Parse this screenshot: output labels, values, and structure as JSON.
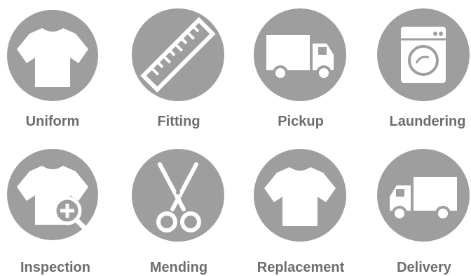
{
  "services": [
    {
      "label": "Uniform",
      "icon": "tshirt-icon"
    },
    {
      "label": "Fitting",
      "icon": "ruler-icon"
    },
    {
      "label": "Pickup",
      "icon": "truck-icon"
    },
    {
      "label": "Laundering",
      "icon": "washing-machine-icon"
    },
    {
      "label": "Inspection",
      "icon": "tshirt-magnifier-plus-icon"
    },
    {
      "label": "Mending",
      "icon": "scissors-icon"
    },
    {
      "label": "Replacement",
      "icon": "tshirt-icon"
    },
    {
      "label": "Delivery",
      "icon": "truck-icon"
    }
  ],
  "colors": {
    "circle": "#9e9e9e",
    "icon": "#ffffff",
    "label": "#6d6d6d"
  }
}
